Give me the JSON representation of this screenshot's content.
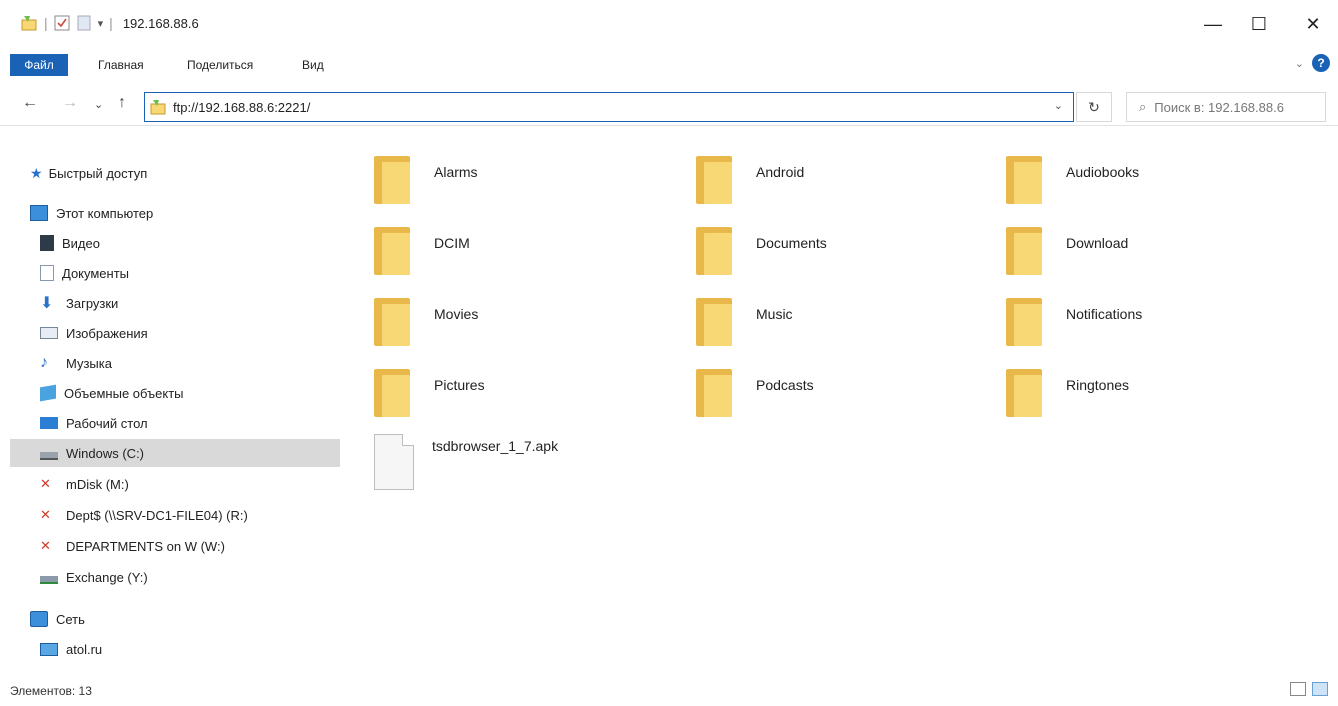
{
  "window": {
    "title": "192.168.88.6",
    "minimize": "—",
    "maximize": "☐",
    "close": "✕"
  },
  "ribbon": {
    "tabs": [
      "Файл",
      "Главная",
      "Поделиться",
      "Вид"
    ],
    "help": "?"
  },
  "address": {
    "path": "ftp://192.168.88.6:2221/",
    "search_placeholder": "Поиск в: 192.168.88.6"
  },
  "sidebar": {
    "items": [
      {
        "label": "Быстрый доступ",
        "icon": "star-icon"
      },
      {
        "label": "Этот компьютер",
        "icon": "computer-icon"
      },
      {
        "label": "Видео",
        "icon": "video-icon"
      },
      {
        "label": "Документы",
        "icon": "documents-icon"
      },
      {
        "label": "Загрузки",
        "icon": "downloads-icon"
      },
      {
        "label": "Изображения",
        "icon": "pictures-icon"
      },
      {
        "label": "Музыка",
        "icon": "music-icon"
      },
      {
        "label": "Объемные объекты",
        "icon": "3d-objects-icon"
      },
      {
        "label": "Рабочий стол",
        "icon": "desktop-icon"
      },
      {
        "label": "Windows (C:)",
        "icon": "drive-icon"
      },
      {
        "label": "mDisk (M:)",
        "icon": "network-drive-disconnected-icon"
      },
      {
        "label": "Dept$ (\\\\SRV-DC1-FILE04) (R:)",
        "icon": "network-drive-disconnected-icon"
      },
      {
        "label": "DEPARTMENTS on W (W:)",
        "icon": "network-drive-disconnected-icon"
      },
      {
        "label": "Exchange (Y:)",
        "icon": "network-drive-icon"
      },
      {
        "label": "Сеть",
        "icon": "network-icon"
      },
      {
        "label": "atol.ru",
        "icon": "network-computer-icon"
      }
    ],
    "selected": "Windows (C:)"
  },
  "content": {
    "folders": [
      "Alarms",
      "Android",
      "Audiobooks",
      "DCIM",
      "Documents",
      "Download",
      "Movies",
      "Music",
      "Notifications",
      "Pictures",
      "Podcasts",
      "Ringtones"
    ],
    "files": [
      "tsdbrowser_1_7.apk"
    ]
  },
  "status": {
    "text": "Элементов: 13"
  },
  "colors": {
    "accent": "#1a62b6",
    "folder_back": "#e8b94a",
    "folder_front": "#f8d775",
    "selection": "#d9d9d9"
  }
}
